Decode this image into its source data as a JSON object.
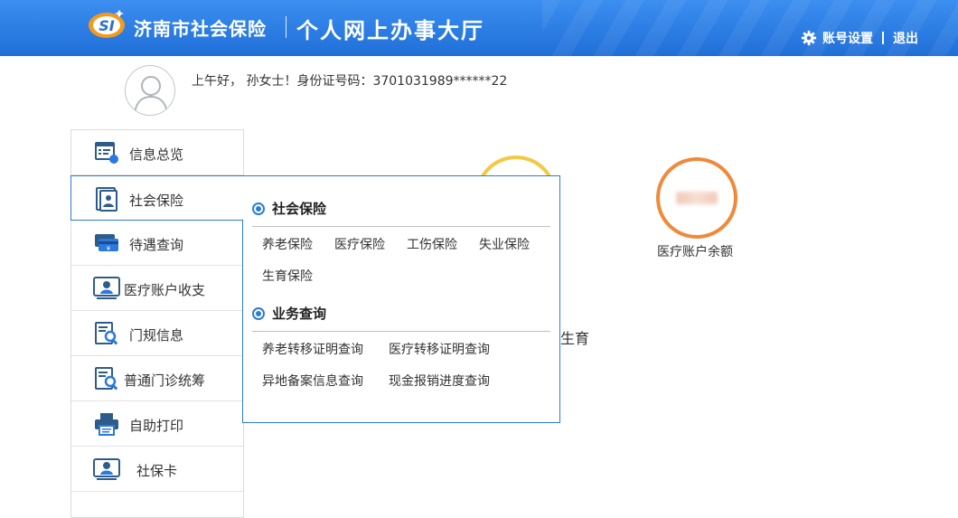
{
  "header": {
    "logo_text": "SI",
    "title_left": "济南市社会保险",
    "title_right": "个人网上办事大厅",
    "account_settings": "账号设置",
    "logout": "退出"
  },
  "greeting": {
    "text": "上午好， 孙女士！身份证号码：3701031989******22"
  },
  "sidebar": {
    "items": [
      {
        "label": "信息总览",
        "icon": "overview-icon"
      },
      {
        "label": "社会保险",
        "icon": "social-insurance-icon"
      },
      {
        "label": "待遇查询",
        "icon": "benefit-card-icon"
      },
      {
        "label": "医疗账户收支",
        "icon": "medical-account-icon"
      },
      {
        "label": "门规信息",
        "icon": "outpatient-search-icon"
      },
      {
        "label": "普通门诊统筹",
        "icon": "clinic-search-icon"
      },
      {
        "label": "自助打印",
        "icon": "printer-icon"
      },
      {
        "label": "社保卡",
        "icon": "id-card-icon"
      }
    ]
  },
  "popup": {
    "section1": {
      "title": "社会保险",
      "links": [
        "养老保险",
        "医疗保险",
        "工伤保险",
        "失业保险",
        "生育保险"
      ]
    },
    "section2": {
      "title": "业务查询",
      "links": [
        "养老转移证明查询",
        "医疗转移证明查询",
        "异地备案信息查询",
        "现金报销进度查询"
      ]
    }
  },
  "dashboard": {
    "medical_balance_label": "医疗账户余额",
    "peek_text": "生育"
  },
  "colors": {
    "header_blue": "#1f6fd8",
    "accent_blue": "#2b7cd3",
    "ring_orange": "#f08a3a",
    "ring_yellow": "#f5c842"
  }
}
